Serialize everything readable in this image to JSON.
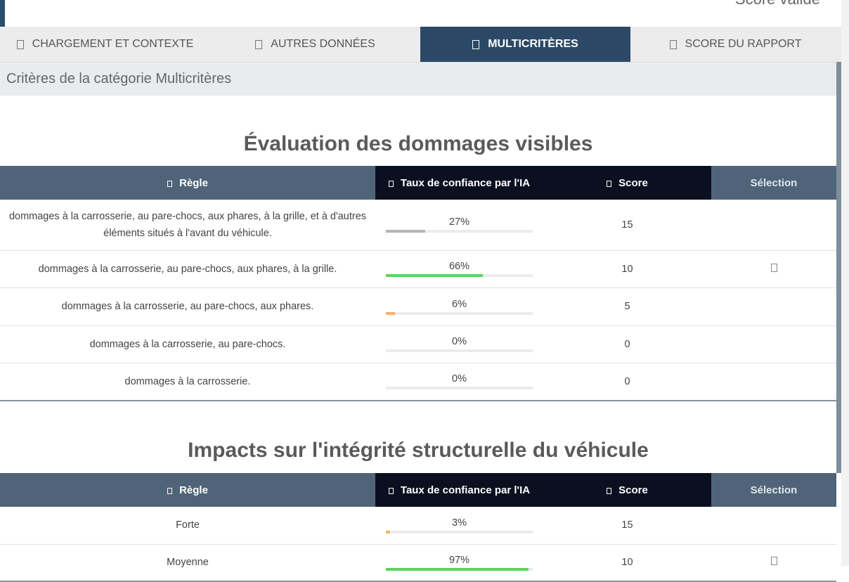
{
  "header": {
    "partial_title": "Score valide"
  },
  "tabs": [
    {
      "label": "CHARGEMENT ET CONTEXTE",
      "active": false
    },
    {
      "label": "AUTRES DONNÉES",
      "active": false
    },
    {
      "label": "MULTICRITÈRES",
      "active": true
    },
    {
      "label": "SCORE DU RAPPORT",
      "active": false
    }
  ],
  "category_title": "Critères de la catégorie Multicritères",
  "columns": {
    "rule": "Règle",
    "confidence": "Taux de confiance par l'IA",
    "score": "Score",
    "selection": "Sélection"
  },
  "colors": {
    "accent": "#2b4966",
    "bar_gray": "#b5b5b5",
    "bar_green": "#5cd35c",
    "bar_orange": "#f7b267"
  },
  "sections": [
    {
      "title": "Évaluation des dommages visibles",
      "rows": [
        {
          "rule": "dommages à la carrosserie, au pare-chocs, aux phares, à la grille, et à d'autres éléments situés à l'avant du véhicule.",
          "confidence": 27,
          "confidence_label": "27%",
          "bar_color": "#b5b5b5",
          "score": "15",
          "selected": false
        },
        {
          "rule": "dommages à la carrosserie, au pare-chocs, aux phares, à la grille.",
          "confidence": 66,
          "confidence_label": "66%",
          "bar_color": "#5cd35c",
          "score": "10",
          "selected": true
        },
        {
          "rule": "dommages à la carrosserie, au pare-chocs, aux phares.",
          "confidence": 6,
          "confidence_label": "6%",
          "bar_color": "#f7b267",
          "score": "5",
          "selected": false
        },
        {
          "rule": "dommages à la carrosserie, au pare-chocs.",
          "confidence": 0,
          "confidence_label": "0%",
          "bar_color": "#f7b267",
          "score": "0",
          "selected": false
        },
        {
          "rule": "dommages à la carrosserie.",
          "confidence": 0,
          "confidence_label": "0%",
          "bar_color": "#f7b267",
          "score": "0",
          "selected": false
        }
      ]
    },
    {
      "title": "Impacts sur l'intégrité structurelle du véhicule",
      "rows": [
        {
          "rule": "Forte",
          "confidence": 3,
          "confidence_label": "3%",
          "bar_color": "#f7b267",
          "score": "15",
          "selected": false
        },
        {
          "rule": "Moyenne",
          "confidence": 97,
          "confidence_label": "97%",
          "bar_color": "#5cd35c",
          "score": "10",
          "selected": true
        }
      ]
    }
  ]
}
